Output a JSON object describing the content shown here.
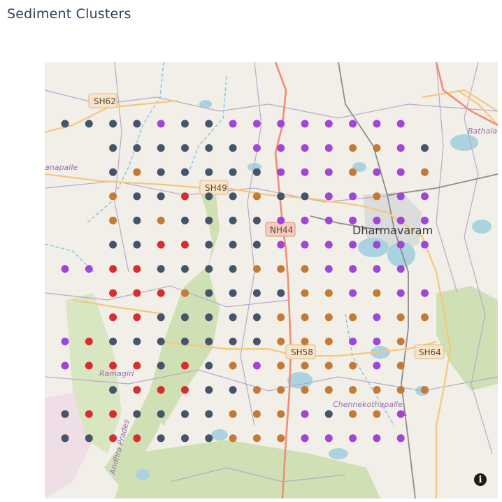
{
  "title": "Sediment Clusters",
  "colors": {
    "dark": "#44546b",
    "purple": "#9f45d8",
    "orange": "#c47a33",
    "red": "#d62e2e"
  },
  "map": {
    "places": {
      "dharmavaram": "Dharmavaram",
      "bathala": "Bathala",
      "anapalle": "anapalle",
      "ramagiri": "Ramagiri",
      "chennekothapalle": "Chennekothapalle",
      "andhra": "Andhra Prades"
    },
    "roads": {
      "sh62": "SH62",
      "sh49": "SH49",
      "nh44": "NH44",
      "sh58": "SH58",
      "sh64": "SH64"
    },
    "info_icon": "info-icon"
  },
  "chart_data": {
    "type": "scatter",
    "title": "Sediment Clusters",
    "grid": [
      "D D D D P D D P P P P P P P P",
      "  D D D D D D P P P P O O P D",
      "  D O D D D D D P P P O P P O",
      "  O D D R D D O D D P P O P P",
      "  O D O D D D D P P P P P P P",
      "  D D R R D D D P P P P P P P",
      "P P R R D D D D O O O P P P P",
      "  R R R O D D D D O O P O P P",
      "  R R D D D D D O O O O P O O",
      "P R D D D D D D D O O O P P O",
      "P R R R D R D O P O O O O P O",
      "  D R R R D D O O O O O O O O",
      "D R R D D D D O O O P D O O P",
      "D D R R D D D O O O P P P P P"
    ],
    "legend": {
      "D": "dark",
      "P": "purple",
      "O": "orange",
      "R": "red"
    }
  }
}
